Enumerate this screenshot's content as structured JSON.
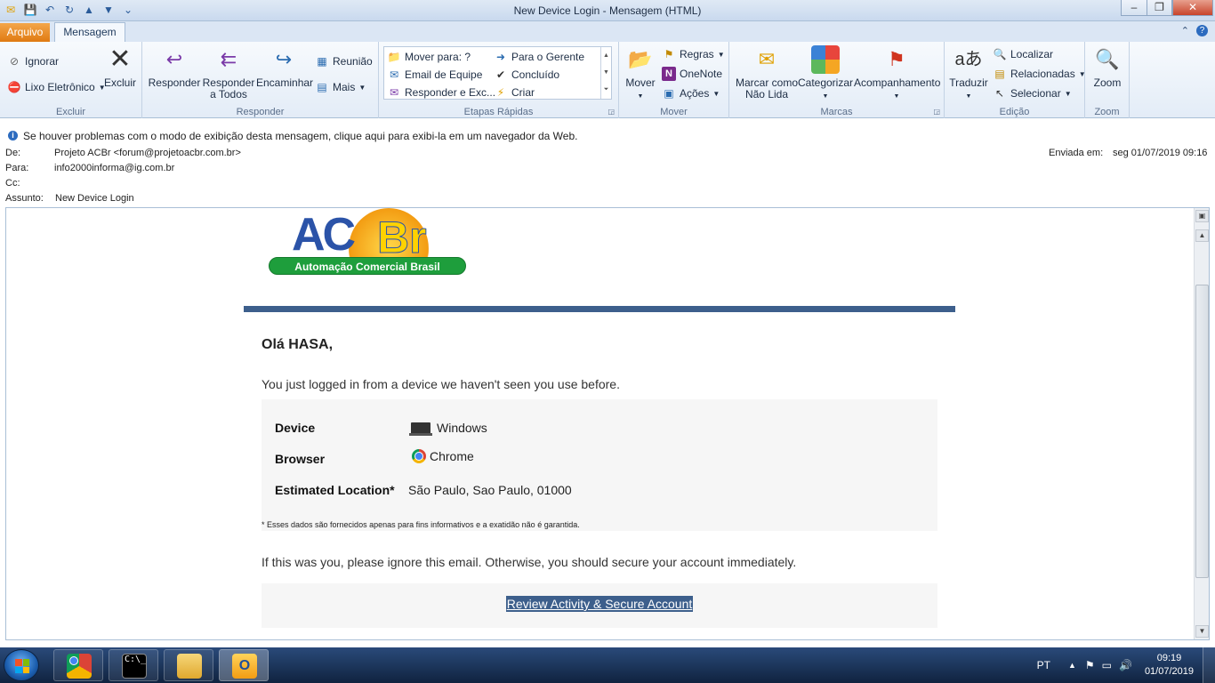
{
  "window": {
    "title": "New Device Login  -  Mensagem (HTML)",
    "minimize": "–",
    "maximize": "❐",
    "close": "✕"
  },
  "tabs": {
    "file": "Arquivo",
    "message": "Mensagem"
  },
  "ribbon": {
    "excluir_group": {
      "label": "Excluir",
      "ignorar": "Ignorar",
      "lixo": "Lixo Eletrônico",
      "excluir": "Excluir"
    },
    "responder_group": {
      "label": "Responder",
      "responder": "Responder",
      "responder_todos_1": "Responder",
      "responder_todos_2": "a Todos",
      "encaminhar": "Encaminhar",
      "reuniao": "Reunião",
      "mais": "Mais"
    },
    "etapas_group": {
      "label": "Etapas Rápidas",
      "mover_para": "Mover para: ?",
      "email_equipe": "Email de Equipe",
      "responder_exc": "Responder e Exc...",
      "para_gerente": "Para o Gerente",
      "concluido": "Concluído",
      "criar": "Criar"
    },
    "mover_group": {
      "label": "Mover",
      "mover": "Mover",
      "regras": "Regras",
      "onenote": "OneNote",
      "acoes": "Ações"
    },
    "marcas_group": {
      "label": "Marcas",
      "marcar_1": "Marcar como",
      "marcar_2": "Não Lida",
      "categorizar": "Categorizar",
      "acompanhamento": "Acompanhamento"
    },
    "edicao_group": {
      "label": "Edição",
      "traduzir": "Traduzir",
      "localizar": "Localizar",
      "relacionadas": "Relacionadas",
      "selecionar": "Selecionar"
    },
    "zoom_group": {
      "label": "Zoom",
      "zoom": "Zoom"
    }
  },
  "infobar": {
    "text": "Se houver problemas com o modo de exibição desta mensagem, clique aqui para exibi-la em um navegador da Web."
  },
  "headers": {
    "from_label": "De:",
    "from_value": "Projeto ACBr <forum@projetoacbr.com.br>",
    "to_label": "Para:",
    "to_value": "info2000informa@ig.com.br",
    "cc_label": "Cc:",
    "subject_label": "Assunto:",
    "subject_value": "New Device Login",
    "sent_label": "Enviada em:",
    "sent_value": "seg 01/07/2019 09:16"
  },
  "email": {
    "logo_ac": "AC",
    "logo_br": "Br",
    "logo_tagline": "Automação Comercial Brasil",
    "greeting": "Olá HASA,",
    "intro": "You just logged in from a device we haven't seen you use before.",
    "device_label": "Device",
    "device_value": "Windows",
    "browser_label": "Browser",
    "browser_value": "Chrome",
    "location_label": "Estimated Location*",
    "location_value": "São Paulo, Sao Paulo, 01000",
    "note": "* Esses dados são fornecidos apenas para fins informativos e a exatidão não é garantida.",
    "warning": "If this was you, please ignore this email. Otherwise, you should secure your account immediately.",
    "cta": "Review Activity & Secure Account"
  },
  "taskbar": {
    "language": "PT",
    "time": "09:19",
    "date": "01/07/2019"
  },
  "colors": {
    "card_top": "#3d5f8c",
    "file_tab": "#e07a12"
  }
}
